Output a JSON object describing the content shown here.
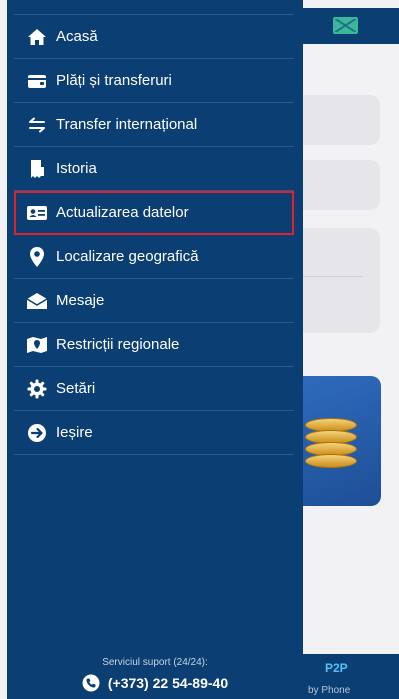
{
  "menu": {
    "items": [
      {
        "label": "Acasă",
        "icon": "home-icon"
      },
      {
        "label": "Plăți și transferuri",
        "icon": "wallet-icon"
      },
      {
        "label": "Transfer internațional",
        "icon": "transfer-arrows-icon"
      },
      {
        "label": "Istoria",
        "icon": "receipt-icon"
      },
      {
        "label": "Actualizarea datelor",
        "icon": "id-card-icon",
        "highlighted": true
      },
      {
        "label": "Localizare geografică",
        "icon": "location-pin-icon"
      },
      {
        "label": "Mesaje",
        "icon": "envelope-open-icon"
      },
      {
        "label": "Restricții regionale",
        "icon": "map-pin-icon"
      },
      {
        "label": "Setări",
        "icon": "gear-icon"
      },
      {
        "label": "Ieșire",
        "icon": "exit-arrow-icon"
      }
    ]
  },
  "support": {
    "label": "Serviciul suport (24/24):",
    "phone": "(+373) 22 54-89-40",
    "icon": "phone-icon"
  },
  "background": {
    "bottom_tab_label": "P2P",
    "bottom_tab_sublabel": "by Phone"
  },
  "colors": {
    "drawer": "#0b3e73",
    "highlight_border": "#e0202b",
    "accent": "#3bb79a"
  }
}
